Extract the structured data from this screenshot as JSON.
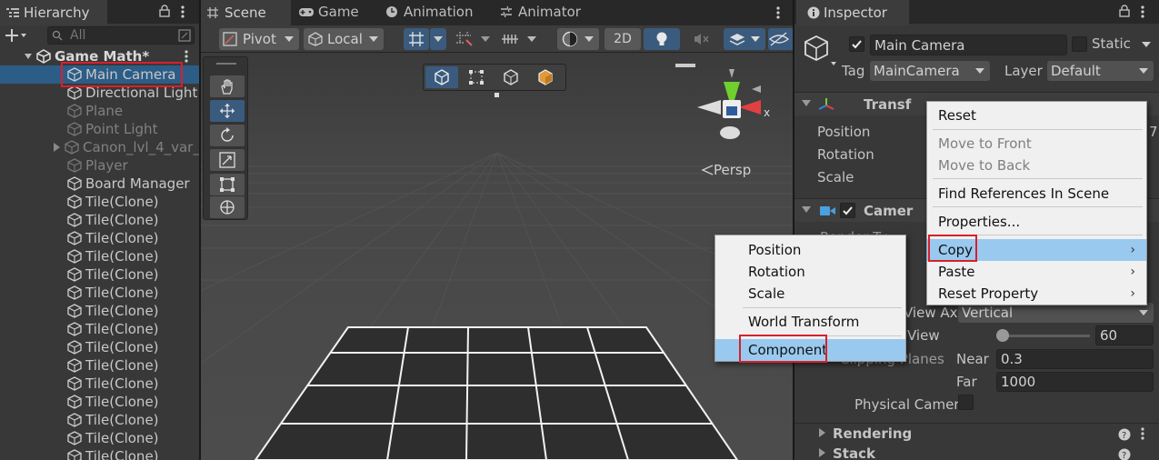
{
  "hierarchy": {
    "tab_label": "Hierarchy",
    "search_placeholder": "All",
    "scene_name": "Game Math*",
    "items": [
      {
        "label": "Main Camera",
        "state": "selected"
      },
      {
        "label": "Directional Light",
        "state": "normal"
      },
      {
        "label": "Plane",
        "state": "dim"
      },
      {
        "label": "Point Light",
        "state": "dim"
      },
      {
        "label": "Canon_lvl_4_var_",
        "state": "dim"
      },
      {
        "label": "Player",
        "state": "dim"
      },
      {
        "label": "Board Manager",
        "state": "normal"
      },
      {
        "label": "Tile(Clone)",
        "state": "normal"
      },
      {
        "label": "Tile(Clone)",
        "state": "normal"
      },
      {
        "label": "Tile(Clone)",
        "state": "normal"
      },
      {
        "label": "Tile(Clone)",
        "state": "normal"
      },
      {
        "label": "Tile(Clone)",
        "state": "normal"
      },
      {
        "label": "Tile(Clone)",
        "state": "normal"
      },
      {
        "label": "Tile(Clone)",
        "state": "normal"
      },
      {
        "label": "Tile(Clone)",
        "state": "normal"
      },
      {
        "label": "Tile(Clone)",
        "state": "normal"
      },
      {
        "label": "Tile(Clone)",
        "state": "normal"
      },
      {
        "label": "Tile(Clone)",
        "state": "normal"
      },
      {
        "label": "Tile(Clone)",
        "state": "normal"
      },
      {
        "label": "Tile(Clone)",
        "state": "normal"
      },
      {
        "label": "Tile(Clone)",
        "state": "normal"
      },
      {
        "label": "Tile(Clone)",
        "state": "normal"
      }
    ]
  },
  "scene": {
    "tabs": [
      "Scene",
      "Game",
      "Animation",
      "Animator"
    ],
    "pivot_label": "Pivot",
    "local_label": "Local",
    "mode_2d_label": "2D",
    "persp_label": "Persp",
    "gizmo_x_label": "x"
  },
  "inspector": {
    "tab_label": "Inspector",
    "object_name": "Main Camera",
    "static_label": "Static",
    "tag_label": "Tag",
    "tag_value": "MainCamera",
    "layer_label": "Layer",
    "layer_value": "Default",
    "transform_label": "Transf",
    "position_label": "Position",
    "rotation_label": "Rotation",
    "scale_label": "Scale",
    "position_x_partial": "7",
    "camera_label": "Camer",
    "render_type_partial": "Render Ty",
    "fov_axis_label": "View Ax",
    "fov_axis_value": "Vertical",
    "fov_label": "View",
    "fov_value": "60",
    "clip_label": "Clipping Planes",
    "near_label": "Near",
    "near_value": "0.3",
    "far_label": "Far",
    "far_value": "1000",
    "physical_label": "Physical Camer",
    "rendering_label": "Rendering",
    "stack_label": "Stack"
  },
  "context_menu": {
    "items": [
      "Reset",
      "Move to Front",
      "Move to Back",
      "Find References In Scene",
      "Properties...",
      "Copy",
      "Paste",
      "Reset Property"
    ]
  },
  "copy_submenu": {
    "items": [
      "Position",
      "Rotation",
      "Scale",
      "World Transform",
      "Component"
    ]
  },
  "colors": {
    "selection": "#2c5d87",
    "menu_highlight": "#99c9ef",
    "annotation_red": "#d8202a"
  }
}
